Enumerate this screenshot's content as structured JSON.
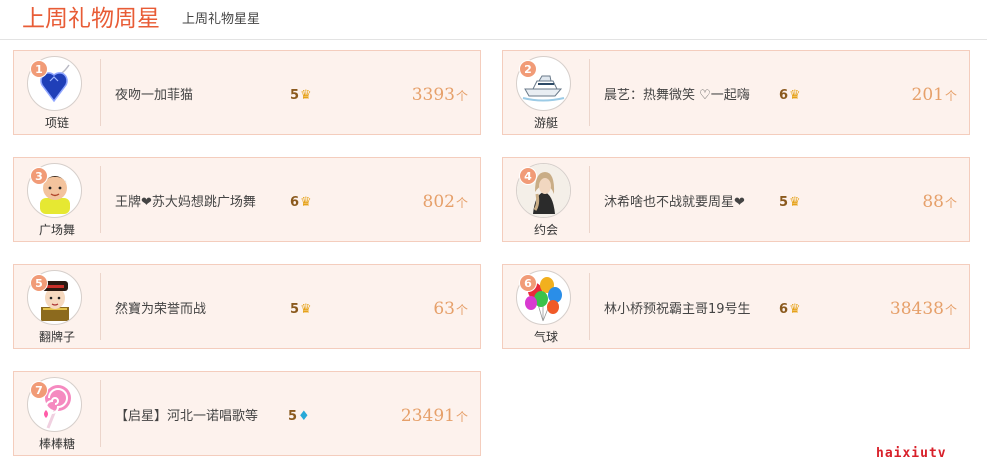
{
  "header": {
    "title": "上周礼物周星",
    "subtitle": "上周礼物星星"
  },
  "cards": [
    {
      "rank": "1",
      "gift": "项链",
      "icon": "necklace-icon",
      "star": "夜吻一加菲猫",
      "level": "5",
      "level_icon": "crown-icon",
      "count": "3393",
      "unit": "个"
    },
    {
      "rank": "2",
      "gift": "游艇",
      "icon": "yacht-icon",
      "star": "晨艺：热舞微笑 ♡一起嗨",
      "level": "6",
      "level_icon": "crown-icon",
      "count": "201",
      "unit": "个"
    },
    {
      "rank": "3",
      "gift": "广场舞",
      "icon": "square-dance-icon",
      "star": "王牌❤苏大妈想跳广场舞",
      "level": "6",
      "level_icon": "crown-icon",
      "count": "802",
      "unit": "个"
    },
    {
      "rank": "4",
      "gift": "约会",
      "icon": "date-icon",
      "star": "沐希啥也不战就要周星❤",
      "level": "5",
      "level_icon": "crown-icon",
      "count": "88",
      "unit": "个"
    },
    {
      "rank": "5",
      "gift": "翻牌子",
      "icon": "emperor-icon",
      "star": "然寶为荣誉而战",
      "level": "5",
      "level_icon": "crown-icon",
      "count": "63",
      "unit": "个"
    },
    {
      "rank": "6",
      "gift": "气球",
      "icon": "balloons-icon",
      "star": "林小桥预祝霸主哥19号生",
      "level": "6",
      "level_icon": "crown-icon",
      "count": "38438",
      "unit": "个"
    },
    {
      "rank": "7",
      "gift": "棒棒糖",
      "icon": "lollipop-icon",
      "star": "【启星】河北一诺唱歌等",
      "level": "5",
      "level_icon": "diamond-icon",
      "count": "23491",
      "unit": "个"
    }
  ],
  "watermark": "haixiutv",
  "colors": {
    "accent": "#e85c36",
    "card_bg": "#fdf2ed",
    "card_border": "#f4cdbd",
    "rank_badge": "#f19b77",
    "count": "#e6a06a"
  }
}
